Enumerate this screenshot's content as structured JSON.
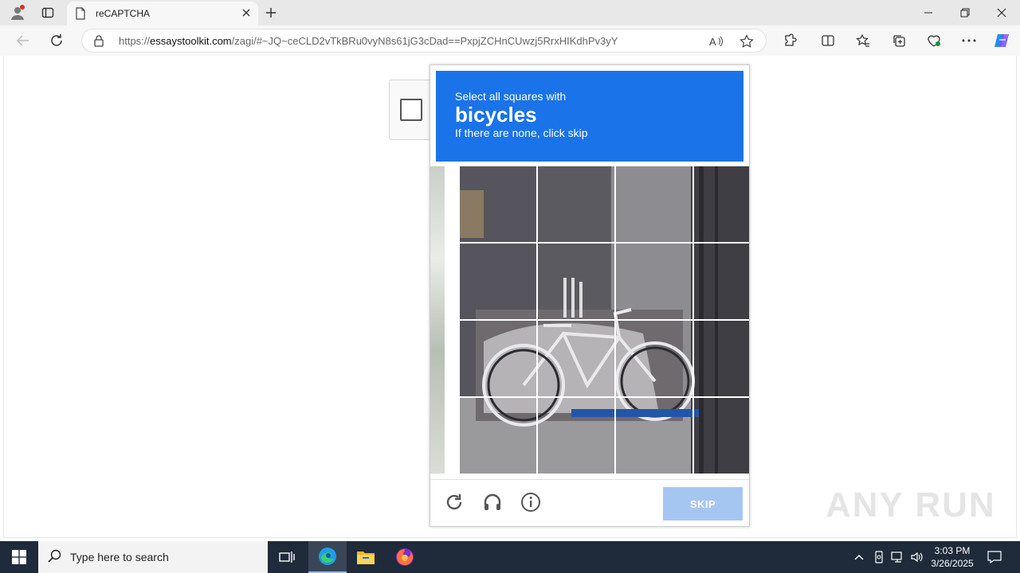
{
  "browser": {
    "tab_title": "reCAPTCHA",
    "url_prefix": "https://",
    "url_host": "essaystoolkit.com",
    "url_path": "/zagi/#~JQ~ceCLD2vTkBRu0vyN8s61jG3cDad==PxpjZCHnCUwzj5RrxHIKdhPv3yY"
  },
  "challenge": {
    "line1": "Select all squares with",
    "keyword": "bicycles",
    "line3": "If there are none, click skip",
    "skip_label": "SKIP",
    "grid_rows": 4,
    "grid_cols": 4
  },
  "watermark": "ANY RUN",
  "taskbar": {
    "search_placeholder": "Type here to search",
    "time": "3:03 PM",
    "date": "3/26/2025"
  },
  "colors": {
    "header_blue": "#1a73e8",
    "skip_disabled": "#a6c6f2",
    "taskbar": "#1f2a3a"
  }
}
